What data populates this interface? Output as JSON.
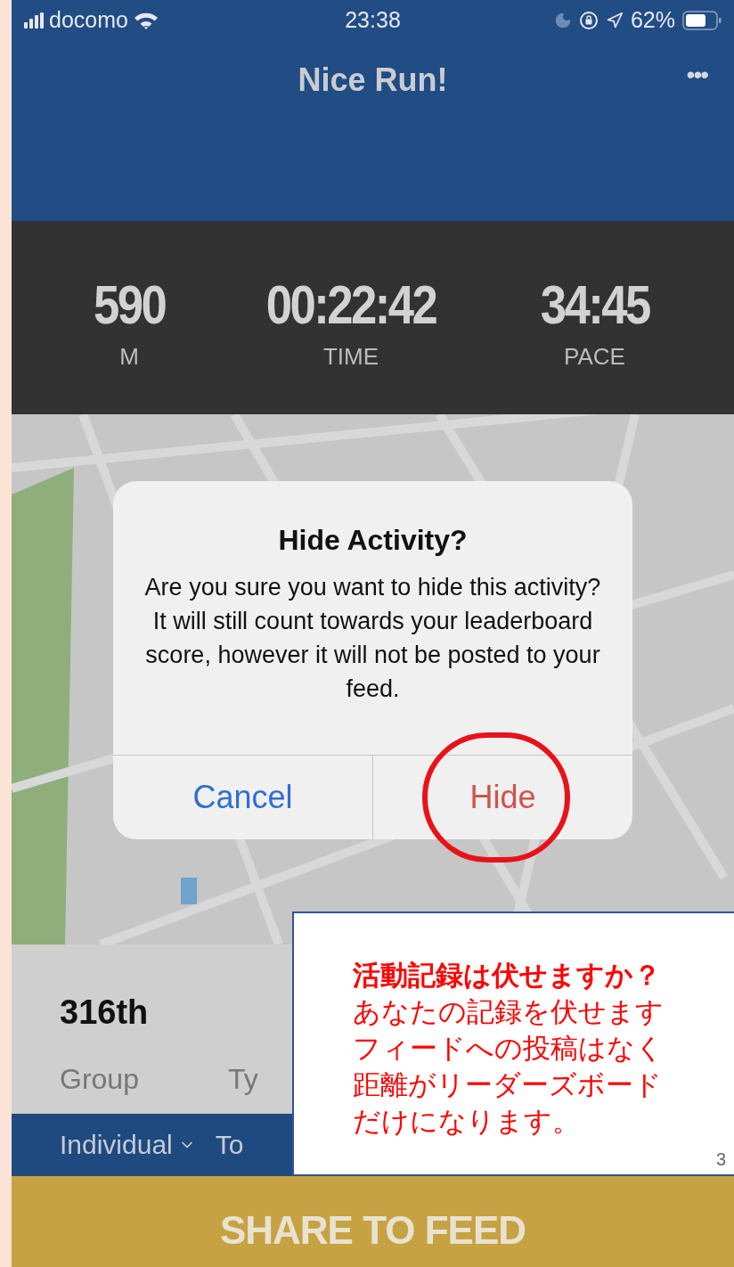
{
  "status_bar": {
    "carrier": "docomo",
    "time": "23:38",
    "battery": "62%"
  },
  "header": {
    "title": "Nice Run!",
    "menu": "•••"
  },
  "stats": [
    {
      "value": "590",
      "label": "M"
    },
    {
      "value": "00:22:42",
      "label": "TIME"
    },
    {
      "value": "34:45",
      "label": "PACE"
    }
  ],
  "dialog": {
    "title": "Hide Activity?",
    "message": "Are you sure you want to hide this activity? It will still count towards your leaderboard score, however it will not be posted to your feed.",
    "buttons": [
      {
        "label": "Cancel",
        "kind": "cancel"
      },
      {
        "label": "Hide",
        "kind": "destructive"
      }
    ]
  },
  "leaderboard": {
    "rank": "316th",
    "labels": [
      "Group",
      "Ty"
    ],
    "filters": [
      "Individual",
      "To"
    ]
  },
  "share_button": "SHARE TO FEED",
  "annotation": {
    "title": "活動記録は伏せますか？",
    "lines": [
      "あなたの記録を伏せます",
      "フィードへの投稿はなく",
      "距離がリーダーズボード",
      "だけになります。"
    ],
    "page": "3"
  }
}
